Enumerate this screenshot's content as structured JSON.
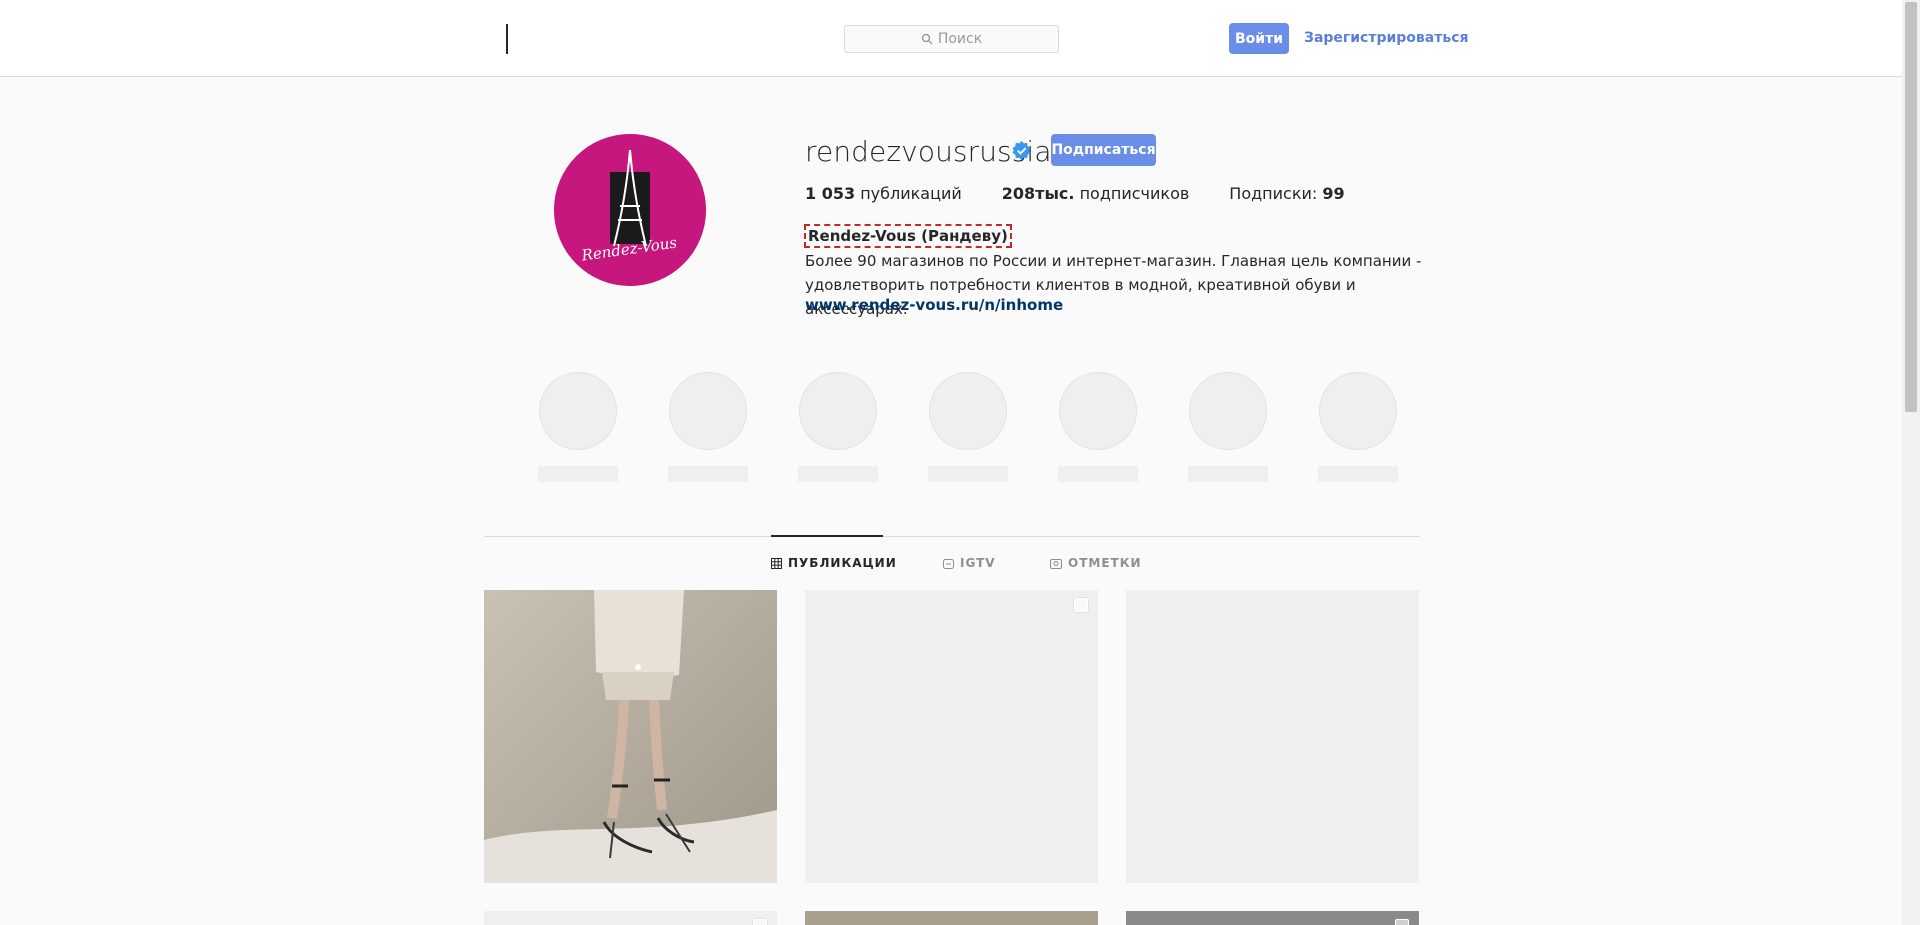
{
  "header": {
    "search_placeholder": "Поиск",
    "login_label": "Войти",
    "register_label": "Зарегистрироваться"
  },
  "profile": {
    "username": "rendezvousrussia",
    "avatar_text": "Rendez-Vous",
    "follow_label": "Подписаться",
    "stats": {
      "posts_count": "1 053",
      "posts_label": "публикаций",
      "followers_count": "208тыс.",
      "followers_label": "подписчиков",
      "following_label": "Подписки:",
      "following_count": "99"
    },
    "bio_name": "Rendez-Vous (Рандеву)",
    "bio_text": "Более 90 магазинов по России и интернет-магазин. Главная цель компании - удовлетворить потребности клиентов в модной, креативной обуви и аксессуарах.",
    "bio_link": "www.rendez-vous.ru/n/inhome"
  },
  "tabs": [
    {
      "label": "ПУБЛИКАЦИИ",
      "active": true
    },
    {
      "label": "IGTV",
      "active": false
    },
    {
      "label": "ОТМЕТКИ",
      "active": false
    }
  ],
  "colors": {
    "accent": "#6a8ee8",
    "brand_magenta": "#c6177e",
    "link": "#003569"
  }
}
